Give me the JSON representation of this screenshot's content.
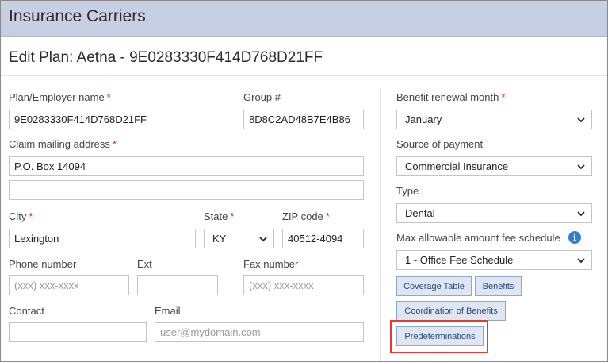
{
  "header": {
    "title": "Insurance Carriers"
  },
  "page": {
    "title": "Edit Plan: Aetna - 9E0283330F414D768D21FF"
  },
  "form": {
    "plan_name": {
      "label": "Plan/Employer name",
      "required": "*",
      "value": "9E0283330F414D768D21FF"
    },
    "group": {
      "label": "Group #",
      "value": "8D8C2AD48B7E4B86"
    },
    "claim_address": {
      "label": "Claim mailing address",
      "required": "*",
      "line1": "P.O. Box 14094",
      "line2": ""
    },
    "city": {
      "label": "City",
      "required": "*",
      "value": "Lexington"
    },
    "state": {
      "label": "State",
      "required": "*",
      "value": "KY"
    },
    "zip": {
      "label": "ZIP code",
      "required": "*",
      "value": "40512-4094"
    },
    "phone": {
      "label": "Phone number",
      "placeholder": "(xxx) xxx-xxxx"
    },
    "ext": {
      "label": "Ext",
      "value": ""
    },
    "fax": {
      "label": "Fax number",
      "placeholder": "(xxx) xxx-xxxx"
    },
    "contact": {
      "label": "Contact",
      "value": ""
    },
    "email": {
      "label": "Email",
      "placeholder": "user@mydomain.com"
    }
  },
  "right": {
    "renewal": {
      "label": "Benefit renewal month",
      "required": "*",
      "value": "January"
    },
    "source": {
      "label": "Source of payment",
      "value": "Commercial Insurance"
    },
    "type": {
      "label": "Type",
      "value": "Dental"
    },
    "fee_schedule": {
      "label": "Max allowable amount fee schedule",
      "value": "1 - Office Fee Schedule",
      "info_icon": "i"
    },
    "buttons": {
      "coverage_table": "Coverage Table",
      "benefits": "Benefits",
      "coordination": "Coordination of Benefits",
      "predeterminations": "Predeterminations"
    }
  },
  "colors": {
    "header_bg": "#c7d0e2",
    "required": "#d9262b",
    "button_bg": "#dde6f2",
    "highlight": "#e53935",
    "info": "#2f7fd1"
  }
}
